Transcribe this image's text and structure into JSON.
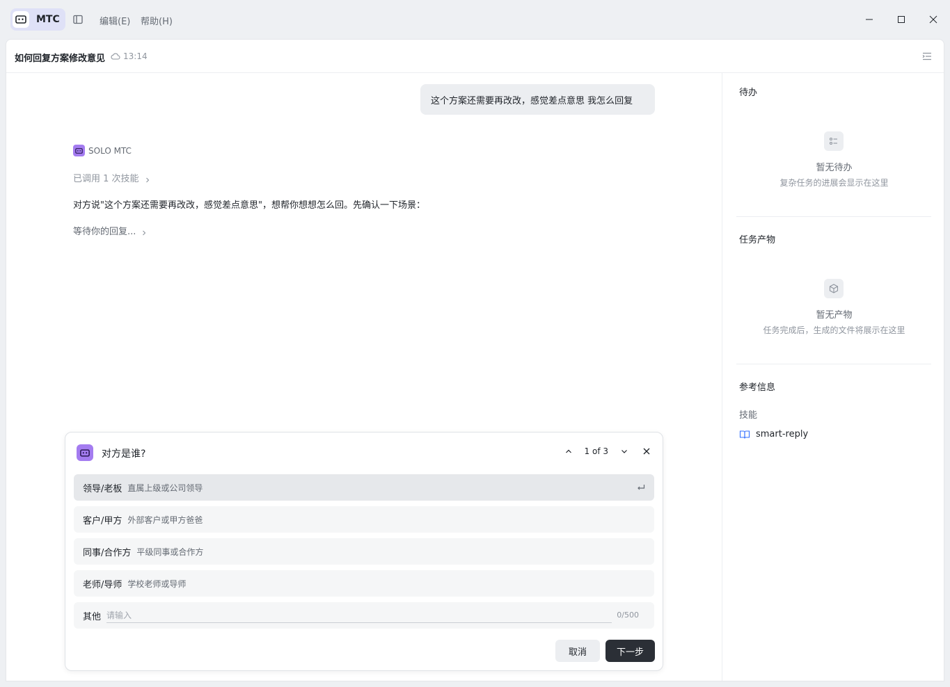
{
  "titlebar": {
    "brand": "MTC",
    "menu": [
      {
        "label": "编辑(E)"
      },
      {
        "label": "帮助(H)"
      }
    ]
  },
  "document": {
    "title": "如何回复方案修改意见",
    "saved_time": "13:14"
  },
  "chat": {
    "user_message": "这个方案还需要再改改，感觉差点意思 我怎么回复",
    "bot_name": "SOLO MTC",
    "skill_used": "已调用 1 次技能",
    "bot_message": "对方说\"这个方案还需要再改改，感觉差点意思\"，想帮你想想怎么回。先确认一下场景：",
    "waiting": "等待你的回复..."
  },
  "question": {
    "title": "对方是谁?",
    "pager": "1 of 3",
    "options": [
      {
        "label": "领导/老板",
        "desc": "直属上级或公司领导"
      },
      {
        "label": "客户/甲方",
        "desc": "外部客户或甲方爸爸"
      },
      {
        "label": "同事/合作方",
        "desc": "平级同事或合作方"
      },
      {
        "label": "老师/导师",
        "desc": "学校老师或导师"
      }
    ],
    "other_label": "其他",
    "other_placeholder": "请输入",
    "other_value": "",
    "char_count": "0/500",
    "cancel_label": "取消",
    "next_label": "下一步"
  },
  "right_panel": {
    "todo": {
      "title": "待办",
      "empty_title": "暂无待办",
      "empty_desc": "复杂任务的进展会显示在这里"
    },
    "artifacts": {
      "title": "任务产物",
      "empty_title": "暂无产物",
      "empty_desc": "任务完成后，生成的文件将展示在这里"
    },
    "reference": {
      "title": "参考信息",
      "skills_label": "技能",
      "skill_name": "smart-reply"
    }
  },
  "colors": {
    "accent": "#a47cf0",
    "brand_pill": "#dfe1f7",
    "primary_button": "#2b2f36"
  }
}
